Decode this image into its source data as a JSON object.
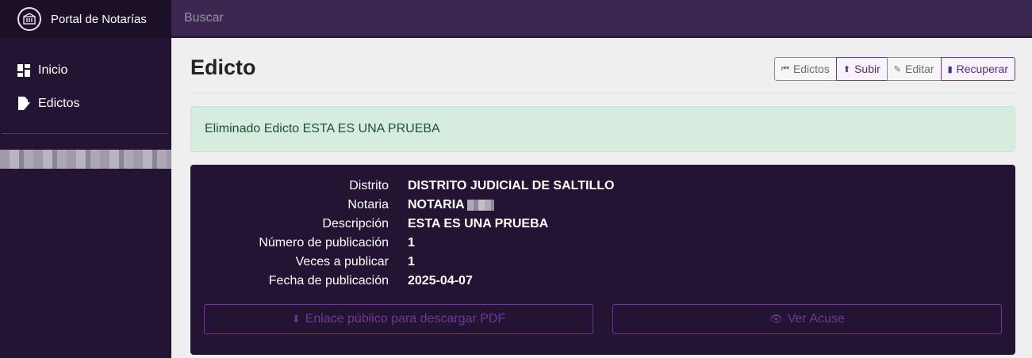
{
  "brand": {
    "title": "Portal de Notarías",
    "logo_icon": "seal-icon"
  },
  "sidebar": {
    "items": [
      {
        "label": "Inicio",
        "icon": "dashboard-icon"
      },
      {
        "label": "Edictos",
        "icon": "document-edit-icon"
      }
    ]
  },
  "topbar": {
    "search_placeholder": "Buscar"
  },
  "page": {
    "title": "Edicto"
  },
  "toolbar": {
    "edictos_label": "Edictos",
    "subir_label": "Subir",
    "editar_label": "Editar",
    "recuperar_label": "Recuperar"
  },
  "alert": {
    "message": "Eliminado Edicto ESTA ES UNA PRUEBA"
  },
  "details": {
    "rows": [
      {
        "label": "Distrito",
        "value": "DISTRITO JUDICIAL DE SALTILLO"
      },
      {
        "label": "Notaria",
        "value": "NOTARIA"
      },
      {
        "label": "Descripción",
        "value": "ESTA ES UNA PRUEBA"
      },
      {
        "label": "Número de publicación",
        "value": "1"
      },
      {
        "label": "Veces a publicar",
        "value": "1"
      },
      {
        "label": "Fecha de publicación",
        "value": "2025-04-07"
      }
    ]
  },
  "actions": {
    "pdf_label": "Enlace público para descargar PDF",
    "acuse_label": "Ver Acuse"
  },
  "colors": {
    "sidebar_bg": "#231434",
    "topbar_bg": "#3b2750",
    "accent": "#6c3a96",
    "alert_bg": "#d5ecdf",
    "alert_text": "#1f5137"
  }
}
